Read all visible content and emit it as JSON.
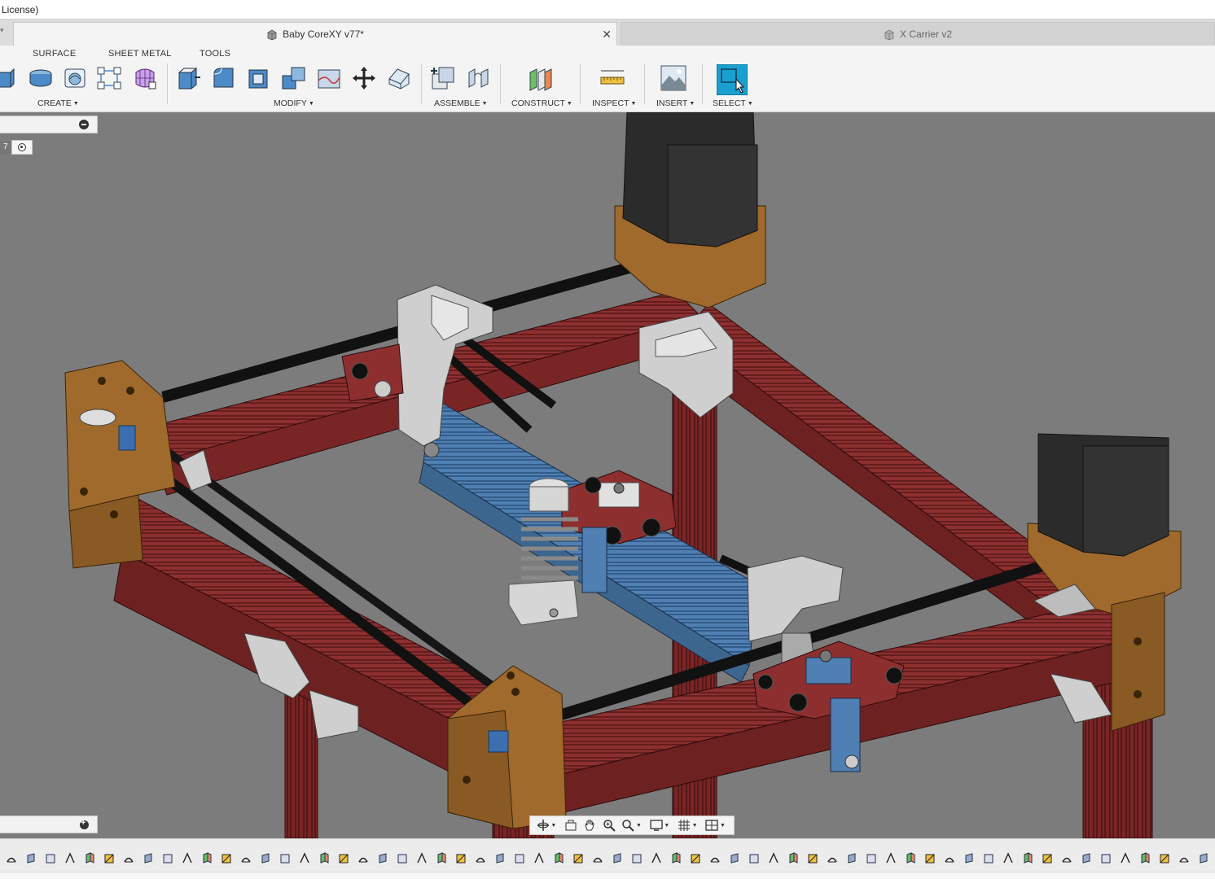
{
  "window": {
    "title_fragment": "License)"
  },
  "tabs": [
    {
      "label": "Baby CoreXY v77*",
      "active": true
    },
    {
      "label": "X Carrier v2",
      "active": false
    }
  ],
  "workspace_tabs": [
    "SURFACE",
    "SHEET METAL",
    "TOOLS"
  ],
  "toolbar_groups": {
    "create": "CREATE",
    "modify": "MODIFY",
    "assemble": "ASSEMBLE",
    "construct": "CONSTRUCT",
    "inspect": "INSPECT",
    "insert": "INSERT",
    "select": "SELECT"
  },
  "browser": {
    "component_number": "7"
  },
  "colors": {
    "viewport_bg": "#7c7c7c",
    "extrusion_red": "#8e2f2f",
    "extrusion_blue": "#4f7fb3",
    "bracket_brown": "#a06a2c",
    "motor_black": "#2b2b2b",
    "part_grey": "#cfcfcf",
    "select_accent": "#1aa0d0"
  },
  "navbar_icons": [
    "orbit-icon",
    "look-at-icon",
    "pan-icon",
    "zoom-icon",
    "fit-icon",
    "display-settings-icon",
    "grid-icon",
    "viewports-icon"
  ]
}
